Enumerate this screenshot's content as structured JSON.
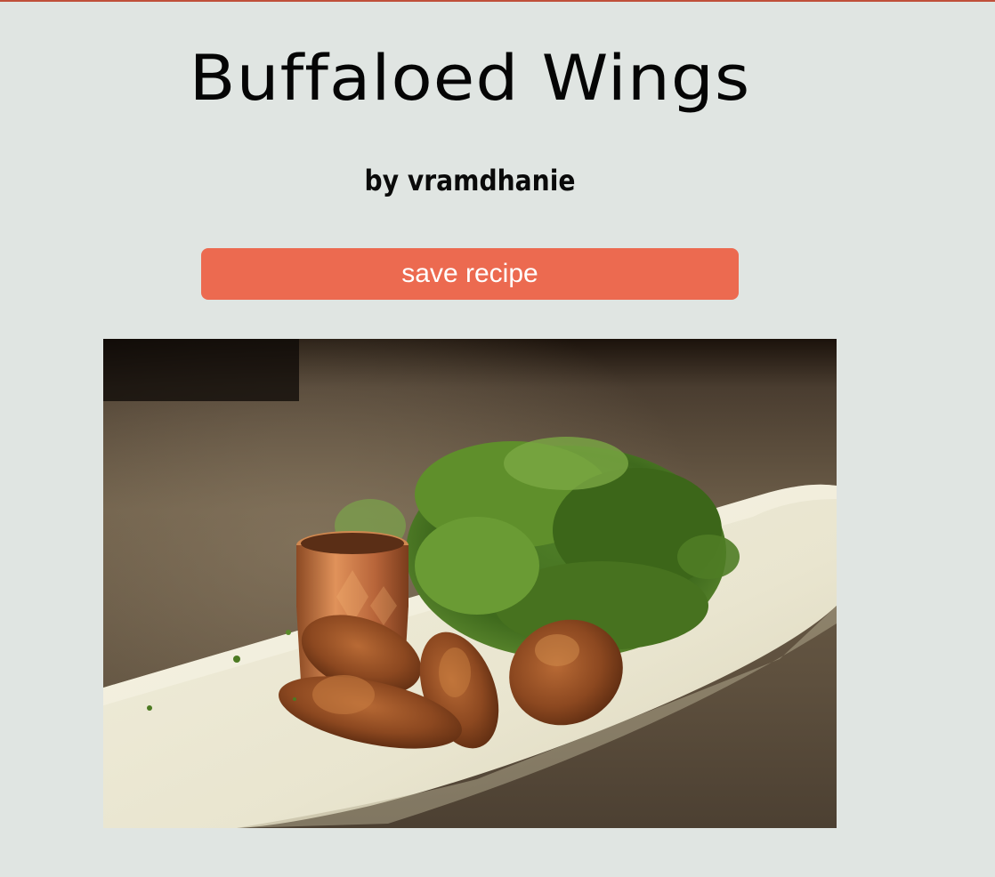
{
  "recipe": {
    "title": "Buffaloed Wings",
    "author": "by vramdhanie",
    "save_label": "save recipe"
  },
  "photo": {
    "subject": "fried chicken wings with green salad and copper dipping cup on a white rectangular plate"
  },
  "colors": {
    "background": "#e0e5e2",
    "accent": "#ec6a50",
    "top_border": "#c0503a"
  }
}
